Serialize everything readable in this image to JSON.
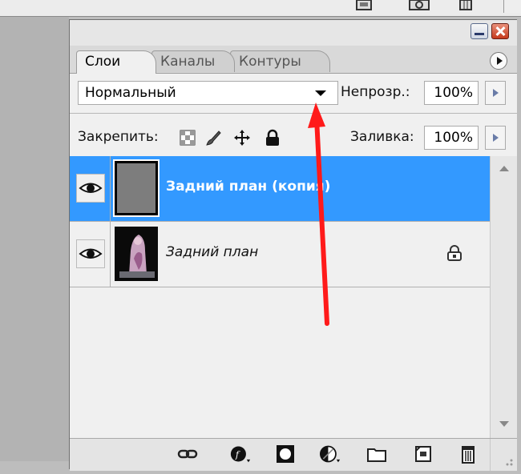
{
  "tabs": [
    {
      "label": "Слои",
      "active": true
    },
    {
      "label": "Каналы",
      "active": false
    },
    {
      "label": "Контуры",
      "active": false
    }
  ],
  "blend_mode": {
    "value": "Нормальный"
  },
  "opacity": {
    "label": "Непрозр.:",
    "value": "100%"
  },
  "lock": {
    "label": "Закрепить:"
  },
  "fill": {
    "label": "Заливка:",
    "value": "100%"
  },
  "layers": [
    {
      "name": "Задний план (копия)",
      "selected": true,
      "visible": true,
      "locked": false
    },
    {
      "name": "Задний план",
      "selected": false,
      "visible": true,
      "locked": true
    }
  ],
  "colors": {
    "selection": "#3399ff",
    "annotation_arrow": "#ff1a1a"
  },
  "icons": {
    "top_panel": [
      "layer-comp-icon",
      "camera-icon",
      "trash-icon"
    ],
    "lock": [
      "lock-transparent-pixels-icon",
      "lock-image-pixels-icon",
      "lock-position-icon",
      "lock-all-icon"
    ],
    "bottom_bar": [
      "link-layers-icon",
      "layer-style-icon",
      "layer-mask-icon",
      "adjustment-layer-icon",
      "new-group-icon",
      "new-layer-icon",
      "delete-layer-icon"
    ]
  }
}
